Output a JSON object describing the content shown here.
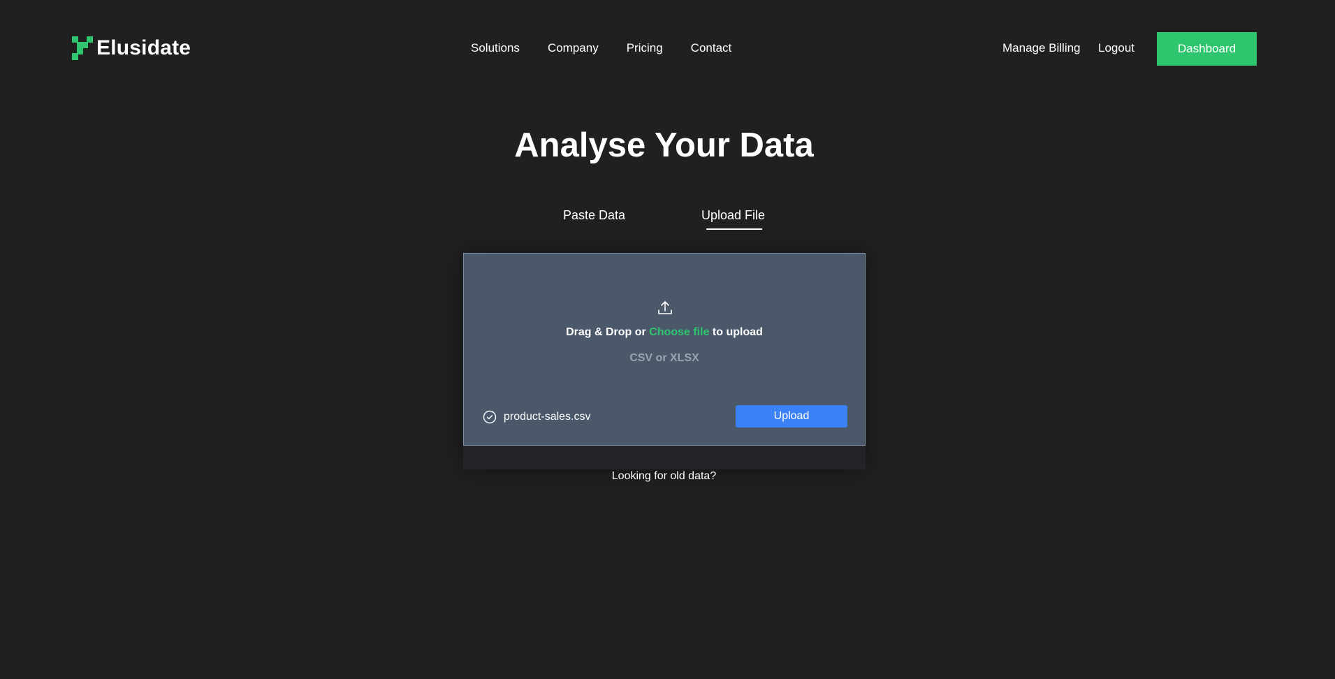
{
  "brand": {
    "name": "Elusidate",
    "accent": "#2fc56e"
  },
  "nav": {
    "links": [
      "Solutions",
      "Company",
      "Pricing",
      "Contact"
    ],
    "manage_billing": "Manage Billing",
    "logout": "Logout",
    "dashboard": "Dashboard"
  },
  "page": {
    "title": "Analyse Your Data"
  },
  "tabs": [
    {
      "label": "Paste Data",
      "active": false
    },
    {
      "label": "Upload File",
      "active": true
    }
  ],
  "dropzone": {
    "icon": "upload-icon",
    "text_before": "Drag & Drop or ",
    "choose_link": "Choose file",
    "text_after": " to upload",
    "formats": "CSV or XLSX",
    "selected_file": "product-sales.csv",
    "file_icon": "check-circle-icon",
    "upload_label": "Upload",
    "upload_color": "#3b82f6"
  },
  "footer_link": "Looking for old data?"
}
